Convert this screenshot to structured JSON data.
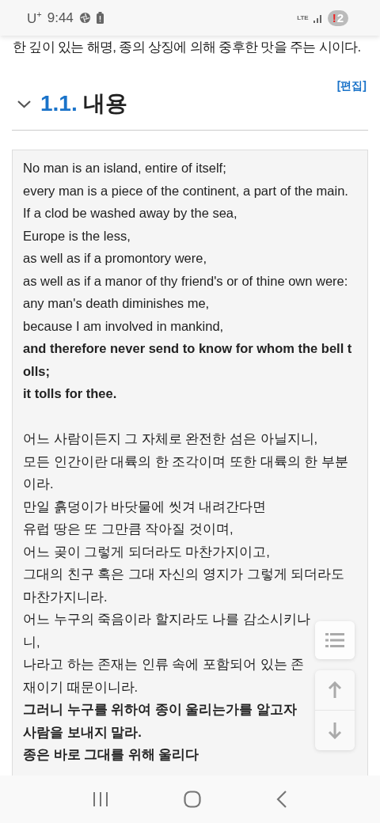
{
  "status_bar": {
    "carrier": "U$^{+}$",
    "time": "9:44",
    "network": "LTE",
    "badge_mark": "!",
    "badge_count": "2"
  },
  "intro_text": "한 깊이 있는 해명, 종의 상징에 의해 중후한 맛을 주는 시이다.",
  "section": {
    "expanded": true,
    "number": "1.1.",
    "title": "내용",
    "edit_link": "[편집]"
  },
  "poem": {
    "stanzas": [
      {
        "lines": [
          {
            "text": "No man is an island, entire of itself;",
            "bold": false
          },
          {
            "text": "every man is a piece of the continent, a part of the main.",
            "bold": false
          },
          {
            "text": "If a clod be washed away by the sea,",
            "bold": false
          },
          {
            "text": "Europe is the less,",
            "bold": false
          },
          {
            "text": "as well as if a promontory were,",
            "bold": false
          },
          {
            "text": "as well as if a manor of thy friend's or of thine own were:",
            "bold": false
          },
          {
            "text": "any man's death diminishes me,",
            "bold": false
          },
          {
            "text": "because I am involved in mankind,",
            "bold": false
          },
          {
            "text": "and therefore never send to know for whom the bell tolls;",
            "bold": true
          },
          {
            "text": "it tolls for thee.",
            "bold": true
          }
        ]
      },
      {
        "lines": [
          {
            "text": "어느 사람이든지 그 자체로 완전한 섬은 아닐지니,",
            "bold": false
          },
          {
            "text": "모든 인간이란 대륙의 한 조각이며 또한 대륙의 한 부분이라.",
            "bold": false
          },
          {
            "text": "만일 흙덩이가 바닷물에 씻겨 내려간다면",
            "bold": false
          },
          {
            "text": "유럽 땅은 또 그만큼 작아질 것이며,",
            "bold": false
          },
          {
            "text": "어느 곶이 그렇게 되더라도 마찬가지이고,",
            "bold": false
          },
          {
            "text": "그대의 친구 혹은 그대 자신의 영지가 그렇게 되더라도 마찬가지니라.",
            "bold": false
          },
          {
            "text": "어느 누구의 죽음이라 할지라도 나를 감소시키나니,",
            "bold": false
          },
          {
            "text": "나라고 하는 존재는 인류 속에 포함되어 있는 존재이기 때문이니라.",
            "bold": false
          },
          {
            "text": "그러니 누구를 위하여 종이 울리는가를 알고자 사람을 보내지 말라.",
            "bold": true
          },
          {
            "text": "종은 바로 그대를 위해 울리다",
            "bold": true
          }
        ]
      }
    ]
  }
}
